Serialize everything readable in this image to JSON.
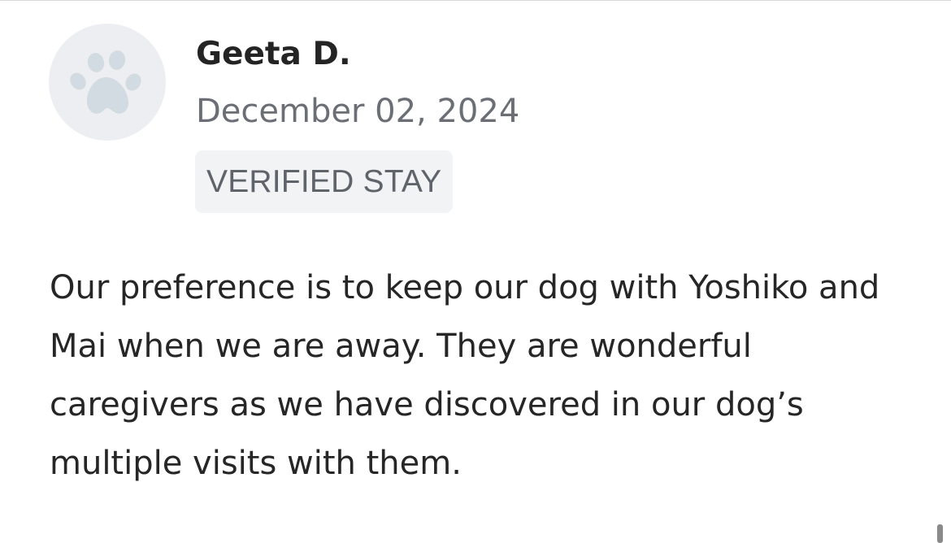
{
  "review": {
    "reviewer_name": "Geeta D.",
    "date": "December 02, 2024",
    "badge": "VERIFIED STAY",
    "text": "Our preference is to keep our dog with Yoshiko and Mai when we are away. They are wonderful caregivers as we have discovered in our dog’s multiple visits with them.",
    "avatar_icon": "paw-print-icon"
  },
  "colors": {
    "avatar_bg": "#eceef1",
    "paw": "#d3dbe2",
    "badge_bg": "#f1f3f5",
    "muted_text": "#6b6f75"
  }
}
